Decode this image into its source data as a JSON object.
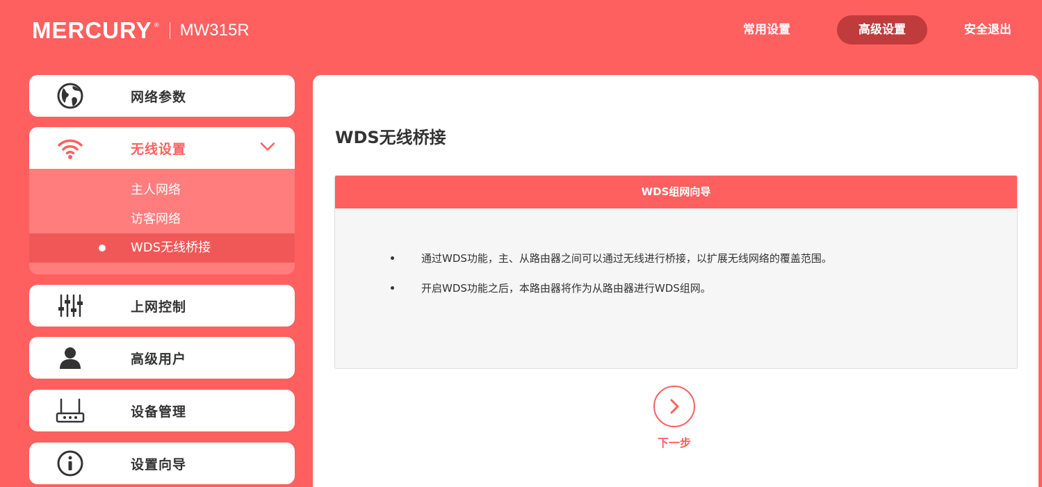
{
  "header": {
    "brand": "MERCURY",
    "brand_mark": "®",
    "model": "MW315R",
    "nav": {
      "common": "常用设置",
      "advanced": "高级设置",
      "logout": "安全退出"
    }
  },
  "sidebar": {
    "items": [
      {
        "label": "网络参数",
        "icon": "globe-icon"
      },
      {
        "label": "无线设置",
        "icon": "wifi-icon",
        "expanded": true
      },
      {
        "label": "上网控制",
        "icon": "sliders-icon"
      },
      {
        "label": "高级用户",
        "icon": "user-icon"
      },
      {
        "label": "设备管理",
        "icon": "router-icon"
      },
      {
        "label": "设置向导",
        "icon": "info-icon"
      }
    ],
    "wireless_sub": [
      {
        "label": "主人网络"
      },
      {
        "label": "访客网络"
      },
      {
        "label": "WDS无线桥接",
        "selected": true
      }
    ]
  },
  "main": {
    "title": "WDS无线桥接",
    "wizard": {
      "header": "WDS组网向导",
      "bullets": [
        "通过WDS功能，主、从路由器之间可以通过无线进行桥接，以扩展无线网络的覆盖范围。",
        "开启WDS功能之后，本路由器将作为从路由器进行WDS组网。"
      ]
    },
    "next_label": "下一步"
  },
  "colors": {
    "accent": "#fe5f5f",
    "nav_active": "#c03c3c",
    "submenu": "#ff7d7d",
    "sub_selected": "#f05858"
  }
}
